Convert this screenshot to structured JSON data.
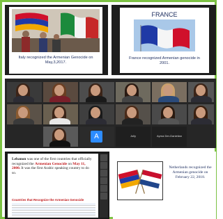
{
  "collage": {
    "italy_slide": {
      "caption": "Italy recognized the Armenian Genocide on May,3,2017."
    },
    "france_slide": {
      "title": "FRANCE",
      "caption": "France recognized Armenian genocide in 2001."
    },
    "gallery": {
      "avatar_letter": "A",
      "name_tiles": [
        "Jolly",
        "Ayrna Der-Danielian"
      ]
    },
    "lebanon_slide": {
      "text_pre": "Lebanon",
      "text_1": " was one of the first countries that officially recognized the ",
      "text_red": "Armenian Genocide",
      "text_2": " on ",
      "date_red": "May 11, 2000.",
      "text_3": " It was the first Arabic speaking country to do so.",
      "table_title": "Countries that Recognize the Armenian Genocide"
    },
    "netherlands_slide": {
      "caption": "Netherlands recognized the Armenian genocide on February 22, 2018."
    }
  },
  "colors": {
    "border": "#7cc243",
    "caption_text": "#1b2c5e",
    "highlight_red": "#c0181b",
    "zoom_blue": "#2d8cff"
  }
}
